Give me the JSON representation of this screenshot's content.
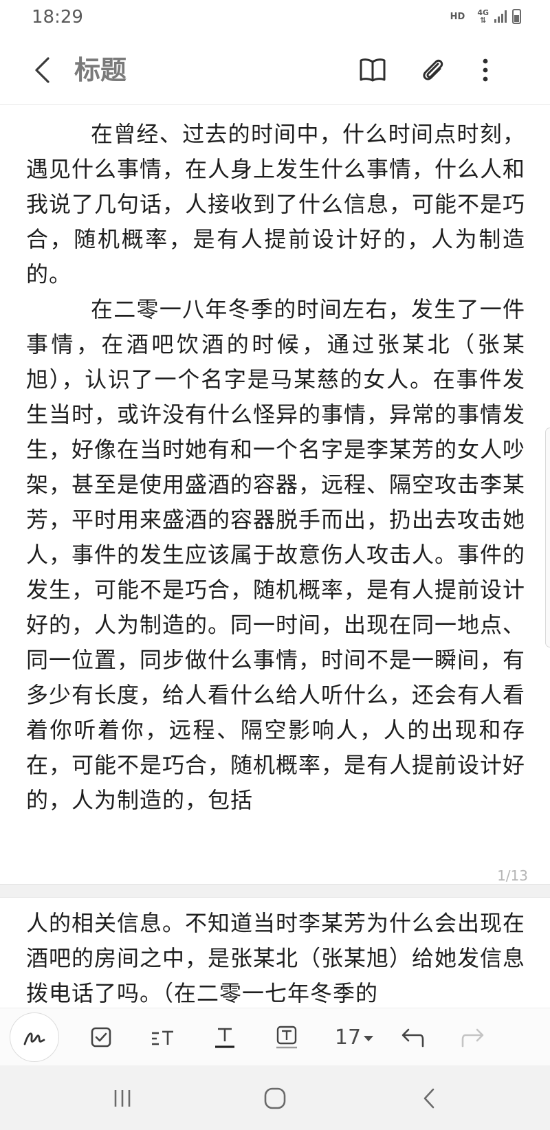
{
  "status_bar": {
    "time": "18:29",
    "hd_label": "HD",
    "network_label": "4G",
    "accent_color": "#5a5a5a"
  },
  "app_bar": {
    "title": "标题",
    "icons": [
      "back-icon",
      "book-icon",
      "paperclip-icon",
      "more-vert-icon"
    ]
  },
  "note": {
    "paragraphs": [
      "在曾经、过去的时间中，什么时间点时刻，遇见什么事情，在人身上发生什么事情，什么人和我说了几句话，人接收到了什么信息，可能不是巧合，随机概率，是有人提前设计好的，人为制造的。",
      "在二零一八年冬季的时间左右，发生了一件事情，在酒吧饮酒的时候，通过张某北（张某旭），认识了一个名字是马某慈的女人。在事件发生当时，或许没有什么怪异的事情，异常的事情发生，好像在当时她有和一个名字是李某芳的女人吵架，甚至是使用盛酒的容器，远程、隔空攻击李某芳，平时用来盛酒的容器脱手而出，扔出去攻击她人，事件的发生应该属于故意伤人攻击人。事件的发生，可能不是巧合，随机概率，是有人提前设计好的，人为制造的。同一时间，出现在同一地点、同一位置，同步做什么事情，时间不是一瞬间，有多少有长度，给人看什么给人听什么，还会有人看着你听着你，远程、隔空影响人，人的出现和存在，可能不是巧合，随机概率，是有人提前设计好的，人为制造的，包括"
    ],
    "page_indicator": "1/13",
    "page2_text": "人的相关信息。不知道当时李某芳为什么会出现在酒吧的房间之中，是张某北（张某旭）给她发信息拨电话了吗。（在二零一七年冬季的"
  },
  "toolbar": {
    "font_size": "17",
    "icons": [
      "pen-icon",
      "checkbox-icon",
      "text-style-icon",
      "underline-text-icon",
      "text-box-icon",
      "undo-icon",
      "redo-icon"
    ]
  },
  "nav_bar": {
    "icons": [
      "recent-apps-icon",
      "home-icon",
      "nav-back-icon"
    ]
  }
}
